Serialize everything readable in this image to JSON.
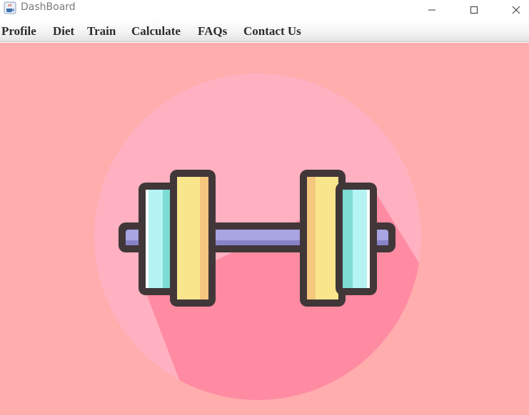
{
  "window": {
    "title": "DashBoard",
    "app_icon": "java-coffee-icon",
    "controls": [
      "minimize-icon",
      "maximize-icon",
      "close-icon"
    ]
  },
  "menu": {
    "items": [
      {
        "label": "Profile"
      },
      {
        "label": "Diet"
      },
      {
        "label": "Train"
      },
      {
        "label": "Calculate"
      },
      {
        "label": "FAQs"
      },
      {
        "label": "Contact Us"
      }
    ]
  },
  "main": {
    "illustration": "dumbbell-icon",
    "colors": {
      "background": "#ffadad",
      "circle": "#ffb1c1",
      "shadow": "#ff8ba2",
      "outline": "#413739",
      "bar": "#a9a4e2",
      "inner_plate": "#b5f4f3",
      "outer_plate": "#f8e58c"
    }
  }
}
